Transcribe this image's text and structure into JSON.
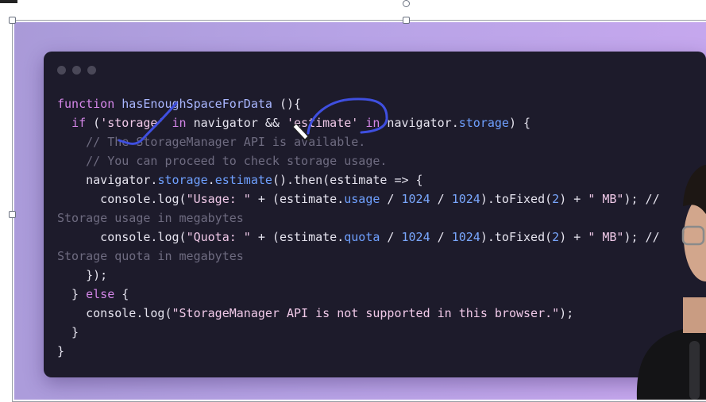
{
  "editor": {
    "window_dots": [
      "dot",
      "dot",
      "dot"
    ],
    "lines": [
      {
        "tokens": [
          {
            "t": "kw",
            "v": "function "
          },
          {
            "t": "fn",
            "v": "hasEnoughSpaceForData"
          },
          {
            "t": "plain",
            "v": " (){"
          }
        ]
      },
      {
        "tokens": [
          {
            "t": "plain",
            "v": "  "
          },
          {
            "t": "kw",
            "v": "if"
          },
          {
            "t": "plain",
            "v": " ("
          },
          {
            "t": "str",
            "v": "'storage'"
          },
          {
            "t": "plain",
            "v": " "
          },
          {
            "t": "kw",
            "v": "in"
          },
          {
            "t": "plain",
            "v": " navigator && "
          },
          {
            "t": "str",
            "v": "'estimate'"
          },
          {
            "t": "plain",
            "v": " "
          },
          {
            "t": "kw",
            "v": "in"
          },
          {
            "t": "plain",
            "v": " navigator."
          },
          {
            "t": "prop",
            "v": "storage"
          },
          {
            "t": "plain",
            "v": ") {"
          }
        ]
      },
      {
        "tokens": [
          {
            "t": "plain",
            "v": "    "
          },
          {
            "t": "cmt",
            "v": "// The StorageManager API is available."
          }
        ]
      },
      {
        "tokens": [
          {
            "t": "plain",
            "v": "    "
          },
          {
            "t": "cmt",
            "v": "// You can proceed to check storage usage."
          }
        ]
      },
      {
        "tokens": [
          {
            "t": "plain",
            "v": "    navigator."
          },
          {
            "t": "prop",
            "v": "storage"
          },
          {
            "t": "plain",
            "v": "."
          },
          {
            "t": "prop",
            "v": "estimate"
          },
          {
            "t": "plain",
            "v": "().then(estimate => {"
          }
        ]
      },
      {
        "tokens": [
          {
            "t": "plain",
            "v": "      console.log("
          },
          {
            "t": "str",
            "v": "\"Usage: \""
          },
          {
            "t": "plain",
            "v": " + (estimate."
          },
          {
            "t": "prop",
            "v": "usage"
          },
          {
            "t": "plain",
            "v": " / "
          },
          {
            "t": "num",
            "v": "1024"
          },
          {
            "t": "plain",
            "v": " / "
          },
          {
            "t": "num",
            "v": "1024"
          },
          {
            "t": "plain",
            "v": ").toFixed("
          },
          {
            "t": "num",
            "v": "2"
          },
          {
            "t": "plain",
            "v": ") + "
          },
          {
            "t": "str",
            "v": "\" MB\""
          },
          {
            "t": "plain",
            "v": "); //"
          }
        ]
      },
      {
        "tokens": [
          {
            "t": "cmt",
            "v": "Storage usage in megabytes"
          }
        ]
      },
      {
        "tokens": [
          {
            "t": "plain",
            "v": "      console.log("
          },
          {
            "t": "str",
            "v": "\"Quota: \""
          },
          {
            "t": "plain",
            "v": " + (estimate."
          },
          {
            "t": "prop",
            "v": "quota"
          },
          {
            "t": "plain",
            "v": " / "
          },
          {
            "t": "num",
            "v": "1024"
          },
          {
            "t": "plain",
            "v": " / "
          },
          {
            "t": "num",
            "v": "1024"
          },
          {
            "t": "plain",
            "v": ").toFixed("
          },
          {
            "t": "num",
            "v": "2"
          },
          {
            "t": "plain",
            "v": ") + "
          },
          {
            "t": "str",
            "v": "\" MB\""
          },
          {
            "t": "plain",
            "v": "); //"
          }
        ]
      },
      {
        "tokens": [
          {
            "t": "cmt",
            "v": "Storage quota in megabytes"
          }
        ]
      },
      {
        "tokens": [
          {
            "t": "plain",
            "v": "    });"
          }
        ]
      },
      {
        "tokens": [
          {
            "t": "plain",
            "v": "  } "
          },
          {
            "t": "kw",
            "v": "else"
          },
          {
            "t": "plain",
            "v": " {"
          }
        ]
      },
      {
        "tokens": [
          {
            "t": "plain",
            "v": "    console.log("
          },
          {
            "t": "str",
            "v": "\"StorageManager API is not supported in this browser.\""
          },
          {
            "t": "plain",
            "v": ");"
          }
        ]
      },
      {
        "tokens": [
          {
            "t": "plain",
            "v": "  }"
          }
        ]
      },
      {
        "tokens": [
          {
            "t": "plain",
            "v": "}"
          }
        ]
      }
    ]
  },
  "colors": {
    "background_gradient_start": "#a99ad8",
    "background_gradient_end": "#c8a8ef",
    "editor_bg": "#1d1b2b",
    "keyword": "#d486e8",
    "function_name": "#a9b6ff",
    "string": "#f0c9e8",
    "property": "#6fa0ff",
    "comment": "#6e6b80",
    "annotation_ink": "#3f4fe0"
  },
  "icons": {
    "cursor": "pen-cursor-icon",
    "presenter": "presenter-webcam-overlay"
  }
}
